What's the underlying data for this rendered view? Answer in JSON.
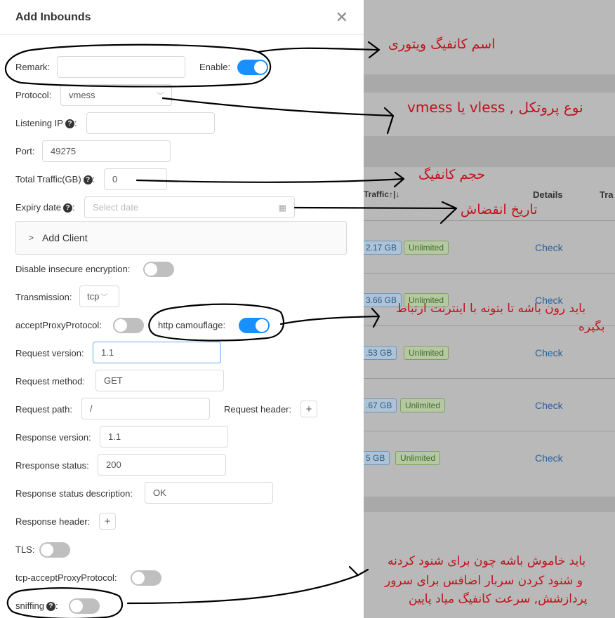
{
  "modal": {
    "title": "Add Inbounds",
    "close_icon": "close-icon",
    "fields": {
      "remark_label": "Remark:",
      "enable_label": "Enable:",
      "protocol_label": "Protocol:",
      "protocol_value": "vmess",
      "listening_ip_label": "Listening IP",
      "port_label": "Port:",
      "port_value": "49275",
      "total_traffic_label": "Total Traffic(GB)",
      "total_traffic_value": "0",
      "expiry_label": "Expiry date",
      "expiry_placeholder": "Select date",
      "add_client_label": "Add Client",
      "disable_insecure_label": "Disable insecure encryption:",
      "transmission_label": "Transmission:",
      "transmission_value": "tcp",
      "accept_proxy_label": "acceptProxyProtocol:",
      "http_camouflage_label": "http camouflage:",
      "request_version_label": "Request version:",
      "request_version_value": "1.1",
      "request_method_label": "Request method:",
      "request_method_value": "GET",
      "request_path_label": "Request path:",
      "request_path_value": "/",
      "request_header_label": "Request header:",
      "response_version_label": "Response version:",
      "response_version_value": "1.1",
      "response_status_label": "Rresponse status:",
      "response_status_value": "200",
      "response_status_desc_label": "Response status description:",
      "response_status_desc_value": "OK",
      "response_header_label": "Response header:",
      "tls_label": "TLS:",
      "tcp_accept_proxy_label": "tcp-acceptProxyProtocol:",
      "sniffing_label": "sniffing"
    },
    "toggles": {
      "enable": true,
      "disable_insecure": false,
      "accept_proxy": false,
      "http_camouflage": true,
      "tls": false,
      "tcp_accept_proxy": false,
      "sniffing": false
    },
    "colon": ":",
    "plus": "+",
    "question_mark": "?"
  },
  "background": {
    "col_traffic": "Traffic↑|↓",
    "col_details": "Details",
    "col_cut": "Tra",
    "rows": [
      {
        "size": "2.17 GB",
        "limit": "Unlimited",
        "action": "Check"
      },
      {
        "size": "3.66 GB",
        "limit": "Unlimited",
        "action": "Check"
      },
      {
        "size": ".53 GB",
        "limit": "Unlimited",
        "action": "Check"
      },
      {
        "size": ".67 GB",
        "limit": "Unlimited",
        "action": "Check"
      },
      {
        "size": "5 GB",
        "limit": "Unlimited",
        "action": "Check"
      }
    ]
  },
  "annotations": {
    "config_name": "اسم کانفیگ ویتوری",
    "protocol_type": "نوع پروتکل , vless  یا  vmess",
    "config_volume": "حجم کانفیگ",
    "expiry": "تاریخ انقضاش",
    "camouflage_line1": "باید رون باشه تا بتونه با اینترنت ارتباط",
    "camouflage_line2": "بگیره",
    "sniffing_line1": "باید خاموش باشه چون برای شنود کردنه",
    "sniffing_line2": "و شنود کردن سربار اضافس برای سرور",
    "sniffing_line3": "پردازشش, سرعت کانفیگ میاد پایین"
  },
  "colors": {
    "accent": "#1890ff",
    "annotation": "#c0121b",
    "overlay": "#a9a9a9"
  }
}
